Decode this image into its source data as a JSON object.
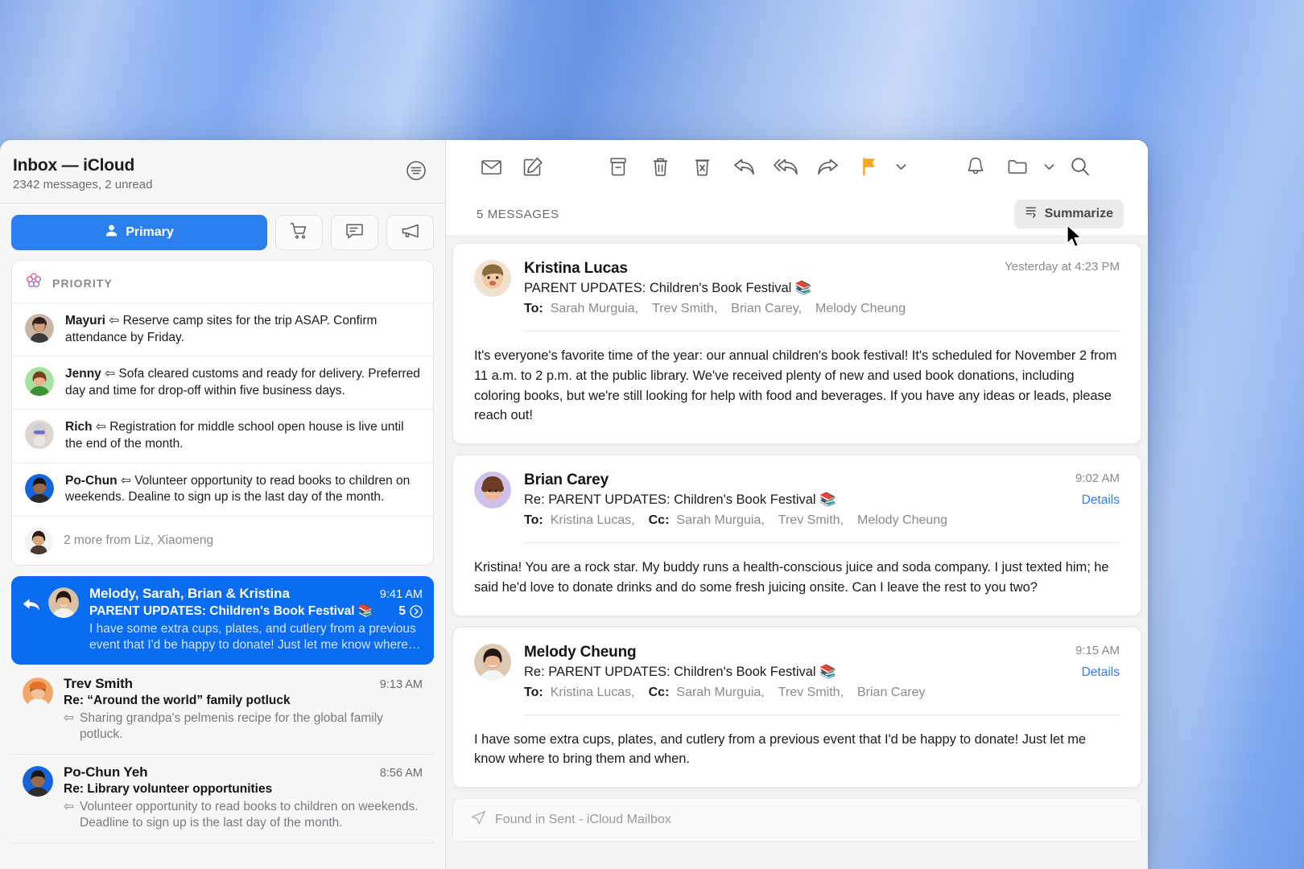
{
  "window": {
    "app": "Mail"
  },
  "sidebar": {
    "title": "Inbox — iCloud",
    "subtitle": "2342 messages, 2 unread",
    "filter_icon": "filter-sort-icon",
    "tabs": [
      {
        "id": "primary",
        "label": "Primary",
        "icon": "person-icon",
        "selected": true
      },
      {
        "id": "transactions",
        "label": "",
        "icon": "cart-icon",
        "selected": false
      },
      {
        "id": "updates",
        "label": "",
        "icon": "chat-bubble-icon",
        "selected": false
      },
      {
        "id": "promotions",
        "label": "",
        "icon": "megaphone-icon",
        "selected": false
      }
    ],
    "priority": {
      "label": "PRIORITY",
      "icon": "apple-intelligence-icon",
      "items": [
        {
          "sender": "Mayuri",
          "summary": "Reserve camp sites for the trip ASAP. Confirm attendance by Friday."
        },
        {
          "sender": "Jenny",
          "summary": "Sofa cleared customs and ready for delivery. Preferred day and time for drop-off within five business days."
        },
        {
          "sender": "Rich",
          "summary": "Registration for middle school open house is live until the end of the month."
        },
        {
          "sender": "Po-Chun",
          "summary": "Volunteer opportunity to read books to children on weekends. Dealine to sign up is the last day of the month."
        }
      ],
      "more_label": "2 more from Liz, Xiaomeng"
    },
    "messages": [
      {
        "from": "Melody, Sarah, Brian & Kristina",
        "time": "9:41 AM",
        "subject": "PARENT UPDATES: Children's Book Festival 📚",
        "preview": "I have some extra cups, plates, and cutlery from a previous event that I'd be happy to donate! Just let me know where…",
        "count": "5",
        "selected": true,
        "has_reply_flag": true
      },
      {
        "from": "Trev Smith",
        "time": "9:13 AM",
        "subject": "Re: “Around the world” family potluck",
        "preview": "Sharing grandpa's pelmenis recipe for the global family potluck.",
        "selected": false
      },
      {
        "from": "Po-Chun Yeh",
        "time": "8:56 AM",
        "subject": "Re: Library volunteer opportunities",
        "preview": "Volunteer opportunity to read books to children on weekends. Deadline to sign up is the last day of the month.",
        "selected": false
      }
    ]
  },
  "reader": {
    "toolbar": [
      {
        "id": "mark-unread",
        "icon": "envelope-icon"
      },
      {
        "id": "compose",
        "icon": "compose-icon"
      },
      {
        "id": "archive",
        "icon": "archive-icon"
      },
      {
        "id": "delete",
        "icon": "trash-icon"
      },
      {
        "id": "junk",
        "icon": "junk-icon"
      },
      {
        "id": "reply",
        "icon": "reply-icon"
      },
      {
        "id": "reply-all",
        "icon": "reply-all-icon"
      },
      {
        "id": "forward",
        "icon": "forward-icon"
      },
      {
        "id": "flag",
        "icon": "flag-icon",
        "color": "#F5A623"
      },
      {
        "id": "flag-menu",
        "icon": "chevron-down-icon"
      },
      {
        "id": "notify",
        "icon": "bell-icon"
      },
      {
        "id": "move",
        "icon": "folder-icon"
      },
      {
        "id": "move-menu",
        "icon": "chevron-down-icon"
      },
      {
        "id": "search",
        "icon": "search-icon"
      }
    ],
    "message_count_label": "5 MESSAGES",
    "summarize_label": "Summarize",
    "summarize_icon": "summarize-icon",
    "details_label": "Details",
    "found_bar": {
      "icon": "paper-plane-icon",
      "text": "Found in Sent - iCloud Mailbox"
    },
    "messages": [
      {
        "name": "Kristina Lucas",
        "time": "Yesterday at 4:23 PM",
        "subject": "PARENT UPDATES: Children's Book Festival 📚",
        "to_label": "To:",
        "to": [
          "Sarah Murguia,",
          "Trev Smith,",
          "Brian Carey,",
          "Melody Cheung"
        ],
        "cc_label": "",
        "cc": [],
        "has_details": false,
        "body": "It's everyone's favorite time of the year: our annual children's book festival! It's scheduled for November 2 from 11 a.m. to 2 p.m. at the public library. We've received plenty of new and used book donations, including coloring books, but we're still looking for help with food and beverages. If you have any ideas or leads, please reach out!"
      },
      {
        "name": "Brian Carey",
        "time": "9:02 AM",
        "subject": "Re: PARENT UPDATES: Children's Book Festival 📚",
        "to_label": "To:",
        "to": [
          "Kristina Lucas,"
        ],
        "cc_label": "Cc:",
        "cc": [
          "Sarah Murguia,",
          "Trev Smith,",
          "Melody Cheung"
        ],
        "has_details": true,
        "body": "Kristina! You are a rock star. My buddy runs a health-conscious juice and soda company. I just texted him; he said he'd love to donate drinks and do some fresh juicing onsite. Can I leave the rest to you two?"
      },
      {
        "name": "Melody Cheung",
        "time": "9:15 AM",
        "subject": "Re: PARENT UPDATES: Children's Book Festival 📚",
        "to_label": "To:",
        "to": [
          "Kristina Lucas,"
        ],
        "cc_label": "Cc:",
        "cc": [
          "Sarah Murguia,",
          "Trev Smith,",
          "Brian Carey"
        ],
        "has_details": true,
        "body": "I have some extra cups, plates, and cutlery from a previous event that I'd be happy to donate! Just let me know where to bring them and when."
      }
    ]
  },
  "colors": {
    "accent": "#2b7fef",
    "selection": "#0a6cf1",
    "flag": "#F5A623",
    "link": "#2b7fef"
  }
}
